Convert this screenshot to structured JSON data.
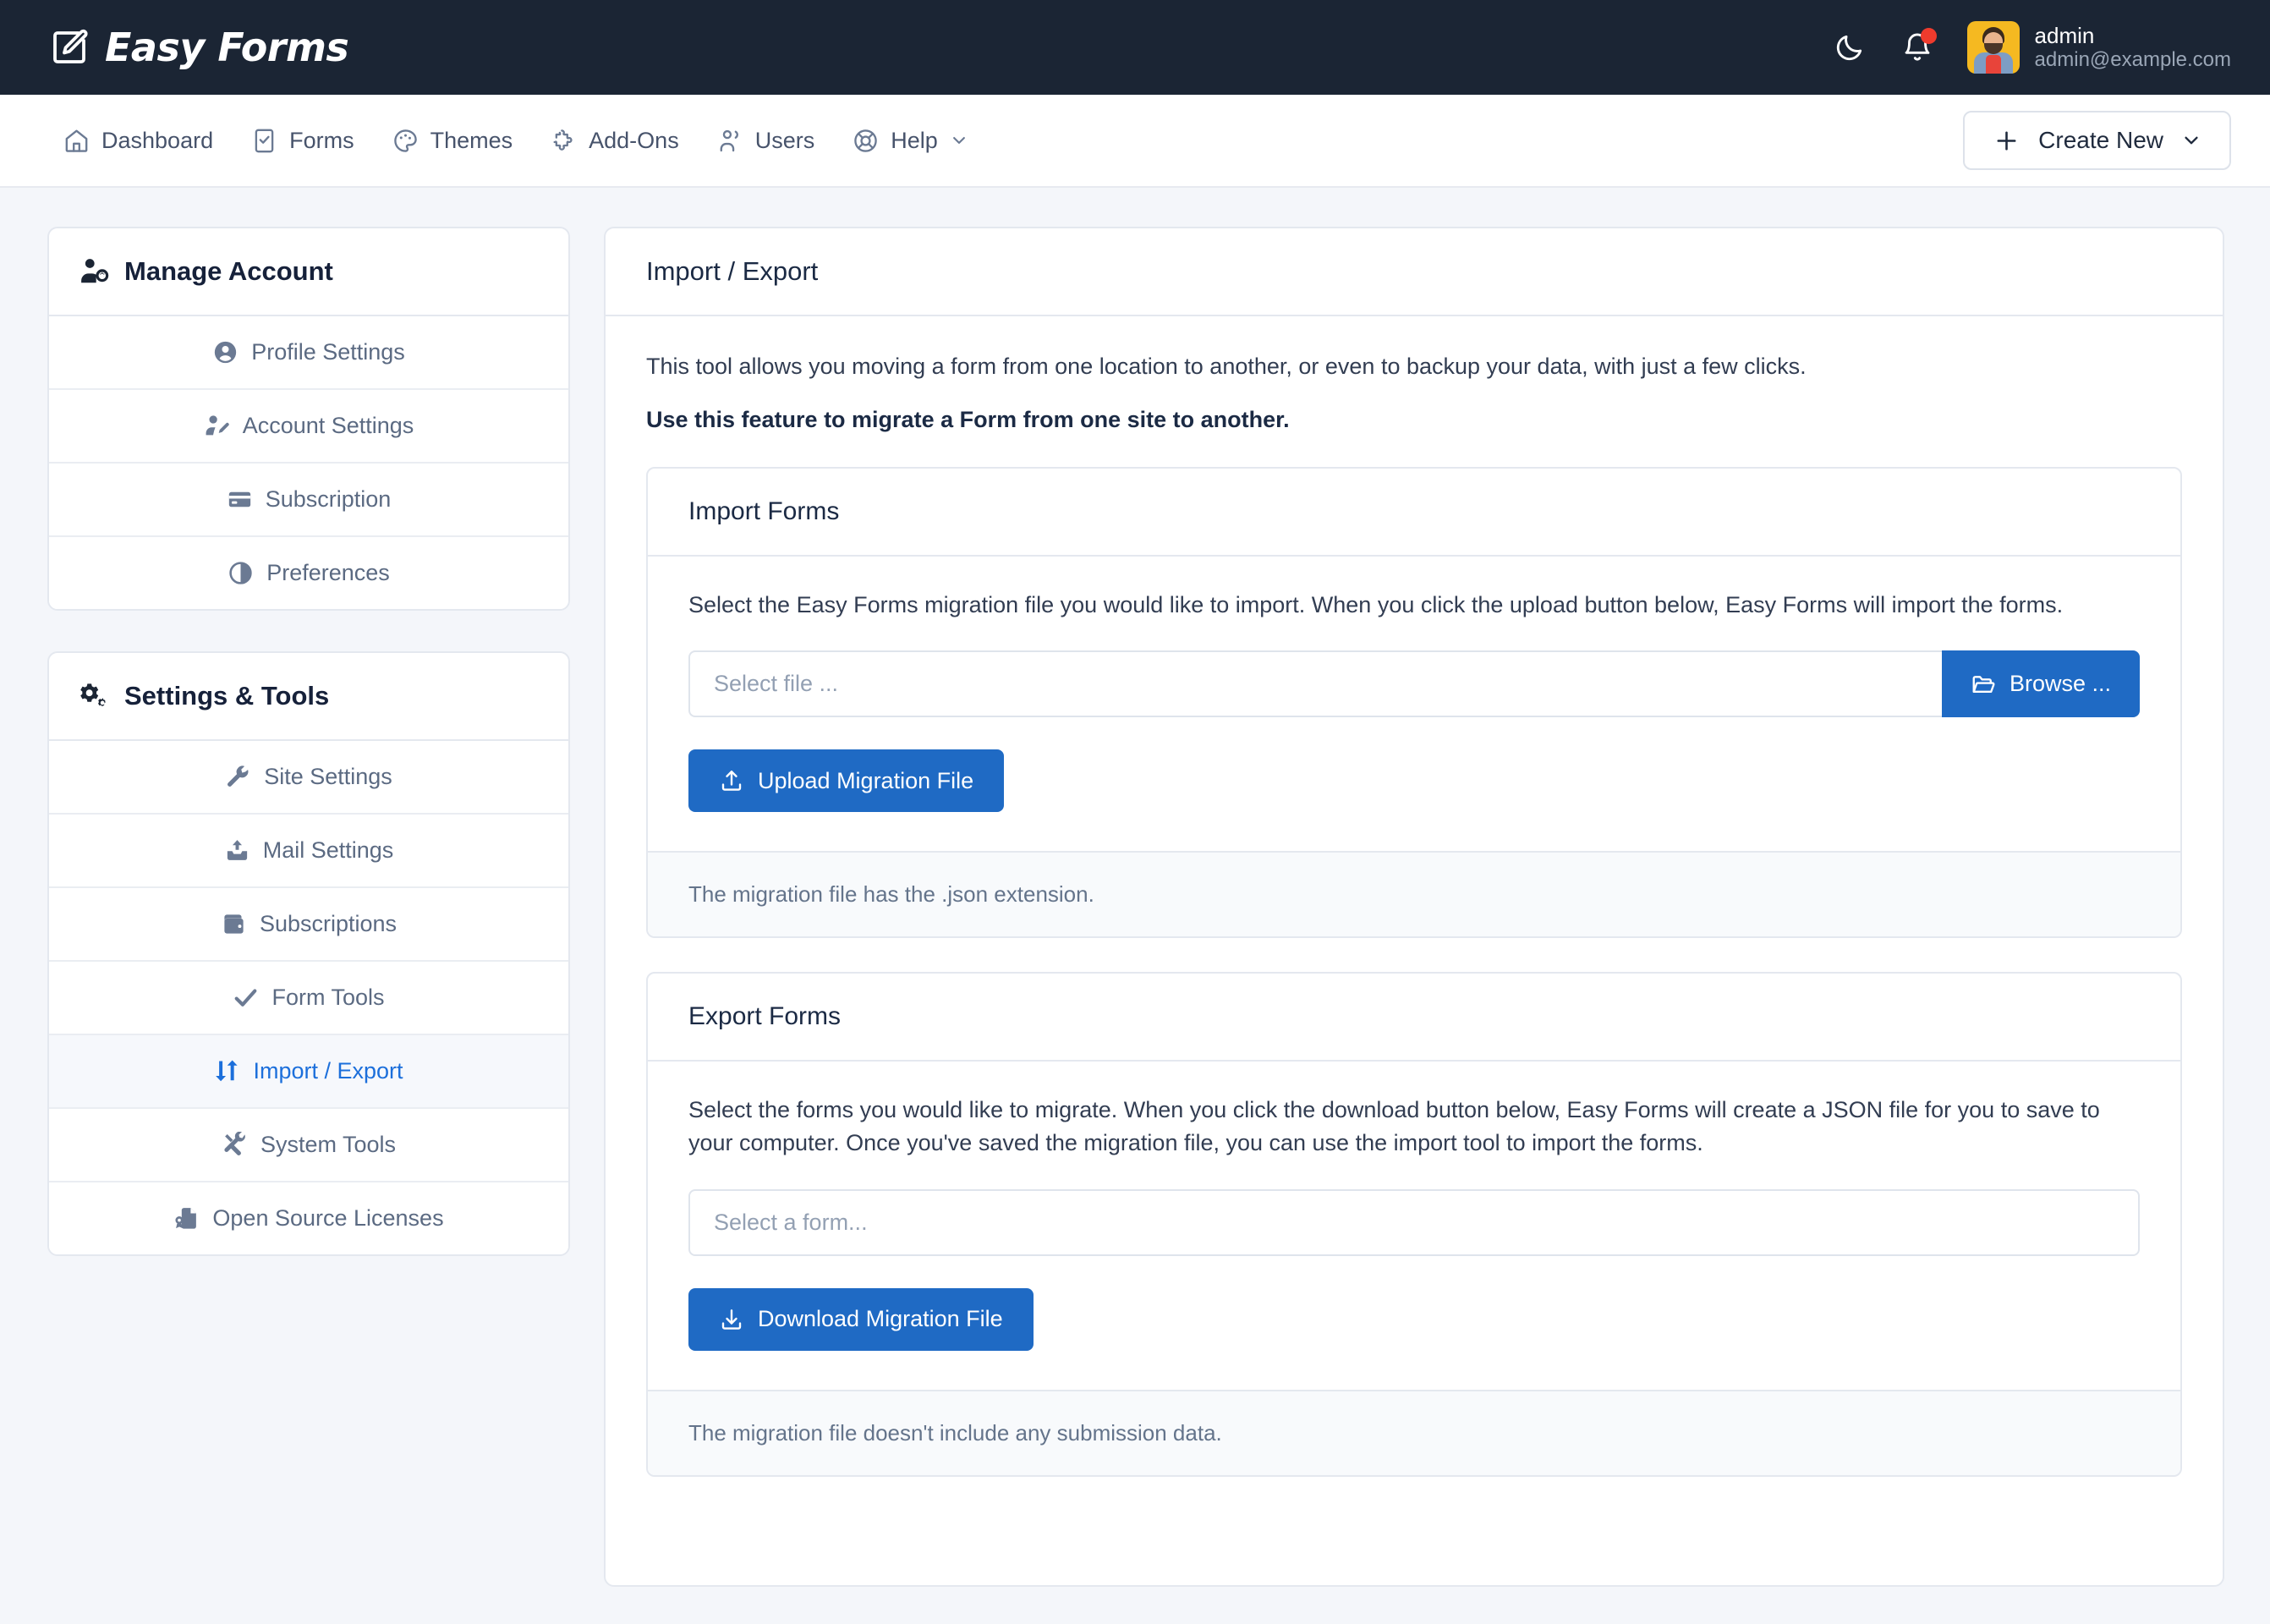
{
  "topbar": {
    "brand": "Easy Forms",
    "brand_icon": "pen-square-icon",
    "dark_mode_icon": "moon-icon",
    "notifications_icon": "bell-icon",
    "user_name": "admin",
    "user_email": "admin@example.com"
  },
  "nav": {
    "items": [
      {
        "label": "Dashboard",
        "icon": "home-icon"
      },
      {
        "label": "Forms",
        "icon": "check-square-icon"
      },
      {
        "label": "Themes",
        "icon": "palette-icon"
      },
      {
        "label": "Add-Ons",
        "icon": "puzzle-icon"
      },
      {
        "label": "Users",
        "icon": "users-icon"
      },
      {
        "label": "Help",
        "icon": "life-buoy-icon"
      }
    ],
    "create_label": "Create New"
  },
  "sidebar": {
    "manage_account": {
      "title": "Manage Account",
      "icon": "user-gear-icon",
      "items": [
        {
          "label": "Profile Settings",
          "icon": "user-circle-icon"
        },
        {
          "label": "Account Settings",
          "icon": "user-edit-icon"
        },
        {
          "label": "Subscription",
          "icon": "credit-card-icon"
        },
        {
          "label": "Preferences",
          "icon": "circle-half-icon"
        }
      ]
    },
    "settings_tools": {
      "title": "Settings & Tools",
      "icon": "cogs-icon",
      "items": [
        {
          "label": "Site Settings",
          "icon": "wrench-icon",
          "active": false
        },
        {
          "label": "Mail Settings",
          "icon": "inbox-upload-icon",
          "active": false
        },
        {
          "label": "Subscriptions",
          "icon": "wallet-icon",
          "active": false
        },
        {
          "label": "Form Tools",
          "icon": "check-icon",
          "active": false
        },
        {
          "label": "Import / Export",
          "icon": "arrows-up-down-icon",
          "active": true
        },
        {
          "label": "System Tools",
          "icon": "tools-icon",
          "active": false
        },
        {
          "label": "Open Source Licenses",
          "icon": "file-certificate-icon",
          "active": false
        }
      ]
    }
  },
  "main": {
    "title": "Import / Export",
    "intro": "This tool allows you moving a form from one location to another, or even to backup your data, with just a few clicks.",
    "intro_strong": "Use this feature to migrate a Form from one site to another.",
    "import": {
      "title": "Import Forms",
      "description": "Select the Easy Forms migration file you would like to import. When you click the upload button below, Easy Forms will import the forms.",
      "file_placeholder": "Select file ...",
      "file_value": "",
      "browse_label": "Browse ...",
      "browse_icon": "folder-open-icon",
      "upload_label": "Upload Migration File",
      "upload_icon": "upload-icon",
      "footnote": "The migration file has the .json extension."
    },
    "export": {
      "title": "Export Forms",
      "description": "Select the forms you would like to migrate. When you click the download button below, Easy Forms will create a JSON file for you to save to your computer. Once you've saved the migration file, you can use the import tool to import the forms.",
      "select_placeholder": "Select a form...",
      "select_value": "",
      "download_label": "Download Migration File",
      "download_icon": "download-icon",
      "footnote": "The migration file doesn't include any submission data."
    }
  },
  "colors": {
    "topbar_bg": "#1b2534",
    "primary": "#1f6ac4",
    "active_link": "#1c6fdb",
    "page_bg": "#f4f6fa",
    "notification": "#ef3b2d"
  }
}
